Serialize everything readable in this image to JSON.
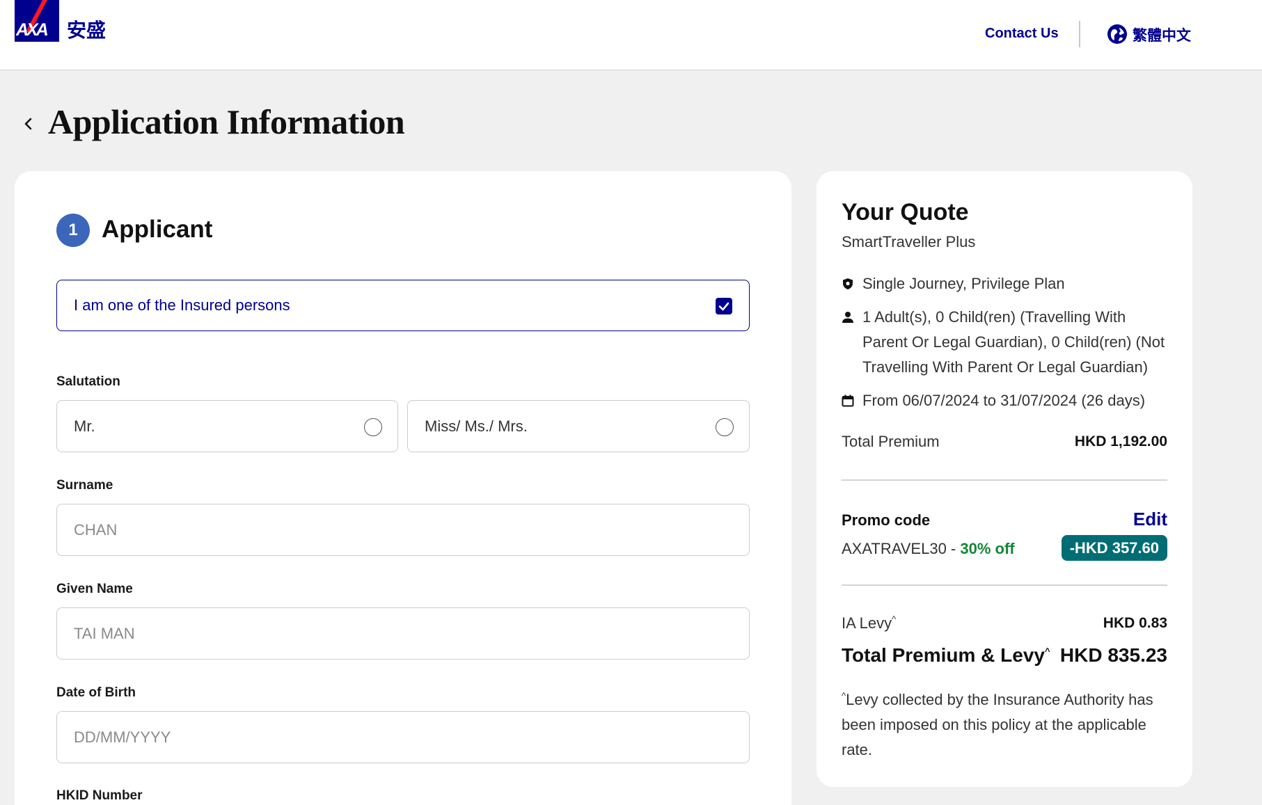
{
  "header": {
    "logo_text": "AXA",
    "logo_cn": "安盛",
    "contact_label": "Contact Us",
    "language_label": "繁體中文"
  },
  "page": {
    "title": "Application Information"
  },
  "applicant": {
    "step_number": "1",
    "step_title": "Applicant",
    "insured_checkbox_label": "I am one of the Insured persons",
    "insured_checked": true,
    "salutation_label": "Salutation",
    "salutation_options": [
      "Mr.",
      "Miss/ Ms./ Mrs."
    ],
    "surname_label": "Surname",
    "surname_placeholder": "CHAN",
    "given_name_label": "Given Name",
    "given_name_placeholder": "TAI MAN",
    "dob_label": "Date of Birth",
    "dob_placeholder": "DD/MM/YYYY",
    "hkid_label": "HKID Number"
  },
  "quote": {
    "title": "Your Quote",
    "product": "SmartTraveller Plus",
    "plan": "Single Journey, Privilege Plan",
    "travellers": "1 Adult(s), 0 Child(ren) (Travelling With Parent Or Legal Guardian), 0 Child(ren) (Not Travelling With Parent Or Legal Guardian)",
    "period": "From 06/07/2024 to 31/07/2024 (26 days)",
    "total_premium_label": "Total Premium",
    "total_premium_value": "HKD 1,192.00",
    "promo_label": "Promo code",
    "promo_edit_label": "Edit",
    "promo_code": "AXATRAVEL30",
    "promo_sep": " - ",
    "promo_discount_text": "30% off",
    "promo_discount_amount": "-HKD 357.60",
    "levy_label": "IA Levy",
    "levy_value": "HKD 0.83",
    "caret": "^",
    "total_label": "Total Premium & Levy",
    "total_value": "HKD 835.23",
    "footnote": "Levy collected by the Insurance Authority has been imposed on this policy at the applicable rate."
  },
  "colors": {
    "brand_blue": "#00008f",
    "step_blue": "#3b66b9",
    "promo_green": "#138636",
    "badge_teal": "#006d75"
  },
  "icons": {
    "back": "chevron-left-icon",
    "language": "globe-icon",
    "plan": "shield-icon",
    "travellers": "person-icon",
    "period": "calendar-icon",
    "checkbox": "checkmark-icon"
  }
}
